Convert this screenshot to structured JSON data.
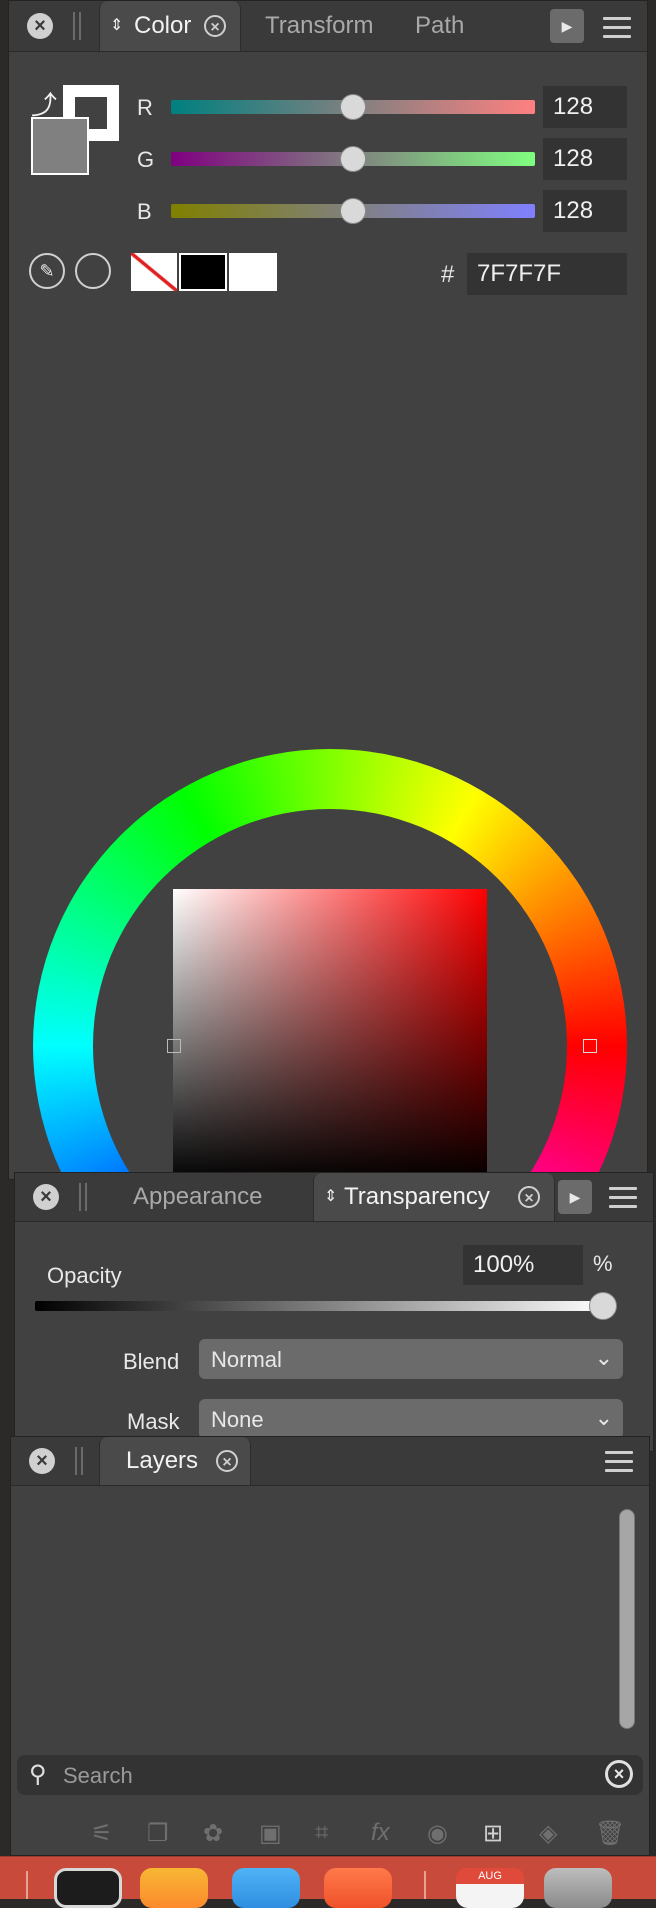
{
  "color_panel": {
    "tabs": [
      "Color",
      "Transform",
      "Path"
    ],
    "sliders": [
      {
        "label": "R",
        "value": "128"
      },
      {
        "label": "G",
        "value": "128"
      },
      {
        "label": "B",
        "value": "128"
      }
    ],
    "slider_level": 0.5,
    "hex_symbol": "#",
    "hex_value": "7F7F7F",
    "current_color": "#808080"
  },
  "transparency_panel": {
    "tabs": [
      "Appearance",
      "Transparency"
    ],
    "opacity_label": "Opacity",
    "opacity_value": "100%",
    "opacity_unit": "%",
    "opacity_level": 1.0,
    "blend_label": "Blend",
    "blend_value": "Normal",
    "mask_label": "Mask",
    "mask_value": "None"
  },
  "layers_panel": {
    "tab": "Layers",
    "search_placeholder": "Search"
  },
  "dock": {
    "calendar_month": "AUG"
  },
  "icons": [
    "close-icon",
    "play-icon",
    "menu-icon",
    "eyedropper-icon",
    "swap-icon",
    "chevron-down-icon",
    "search-icon",
    "trash-icon",
    "camera-icon",
    "fx-icon"
  ]
}
